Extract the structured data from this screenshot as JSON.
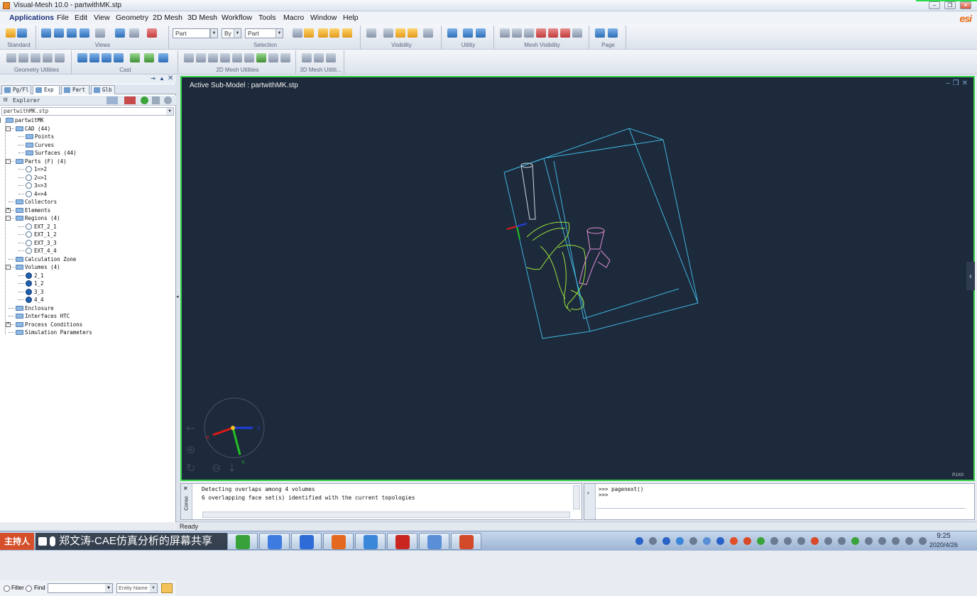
{
  "window": {
    "title": "Visual-Mesh 10.0 - partwithMK.stp",
    "controls": [
      "minimize",
      "restore",
      "close"
    ]
  },
  "menu": [
    "Applications",
    "File",
    "Edit",
    "View",
    "Geometry",
    "2D Mesh",
    "3D Mesh",
    "Workflow",
    "Tools",
    "Macro",
    "Window",
    "Help"
  ],
  "toolbar1": {
    "groups": [
      "Standard",
      "Views",
      "Selection",
      "Visibility",
      "Utility",
      "Mesh Visibility",
      "Page"
    ],
    "selection": {
      "part_left": "Part",
      "by": "By",
      "part_right": "Part"
    }
  },
  "toolbar2": {
    "groups": [
      "Geometry Utilities",
      "Cast",
      "2D Mesh Utilities",
      "3D Mesh Utiliti..."
    ]
  },
  "panel": {
    "tabs": [
      "Pg/Fl",
      "Exp",
      "Part",
      "Glb"
    ],
    "explorer_title": "Explorer",
    "model": "partwithMK.stp",
    "tree": [
      {
        "label": "partwitMK",
        "depth": 0,
        "icon": "folder",
        "exp": "-"
      },
      {
        "label": "CAD (44)",
        "depth": 1,
        "icon": "folder",
        "exp": "-"
      },
      {
        "label": "Points",
        "depth": 2,
        "icon": "folder"
      },
      {
        "label": "Curves",
        "depth": 2,
        "icon": "folder"
      },
      {
        "label": "Surfaces (44)",
        "depth": 2,
        "icon": "folder"
      },
      {
        "label": "Parts (F) (4)",
        "depth": 1,
        "icon": "folder",
        "exp": "-"
      },
      {
        "label": "1=>2",
        "depth": 2,
        "icon": "circle"
      },
      {
        "label": "2=>1",
        "depth": 2,
        "icon": "circle"
      },
      {
        "label": "3=>3",
        "depth": 2,
        "icon": "circle"
      },
      {
        "label": "4=>4",
        "depth": 2,
        "icon": "circle"
      },
      {
        "label": "Collectors",
        "depth": 1,
        "icon": "folder"
      },
      {
        "label": "Elements",
        "depth": 1,
        "icon": "folder",
        "exp": "+"
      },
      {
        "label": "Regions (4)",
        "depth": 1,
        "icon": "folder",
        "exp": "-"
      },
      {
        "label": "EXT_2_1",
        "depth": 2,
        "icon": "circle"
      },
      {
        "label": "EXT_1_2",
        "depth": 2,
        "icon": "circle"
      },
      {
        "label": "EXT_3_3",
        "depth": 2,
        "icon": "circle"
      },
      {
        "label": "EXT_4_4",
        "depth": 2,
        "icon": "circle"
      },
      {
        "label": "Calculation Zone",
        "depth": 1,
        "icon": "folder"
      },
      {
        "label": "Volumes (4)",
        "depth": 1,
        "icon": "folder",
        "exp": "-"
      },
      {
        "label": "2_1",
        "depth": 2,
        "icon": "circle-filled"
      },
      {
        "label": "1_2",
        "depth": 2,
        "icon": "circle-filled"
      },
      {
        "label": "3_3",
        "depth": 2,
        "icon": "circle-filled"
      },
      {
        "label": "4_4",
        "depth": 2,
        "icon": "circle-filled"
      },
      {
        "label": "Enclosure",
        "depth": 1,
        "icon": "folder"
      },
      {
        "label": "Interfaces HTC",
        "depth": 1,
        "icon": "folder"
      },
      {
        "label": "Process Conditions",
        "depth": 1,
        "icon": "folder",
        "exp": "+"
      },
      {
        "label": "Simulation Parameters",
        "depth": 1,
        "icon": "folder"
      }
    ],
    "filter": {
      "filter_label": "Filter",
      "find_label": "Find",
      "entity_name": "Entity Name"
    }
  },
  "viewport": {
    "title": "Active Sub-Model : partwithMK.stp",
    "corner_label": "P1X0",
    "background": "#1d2a3b",
    "border_color": "#35d24a",
    "colors": {
      "box": "#3fb4de",
      "part_green": "#9be23c",
      "part_pink": "#e48fd6",
      "axis_x": "#e01818",
      "axis_y": "#22c222",
      "axis_z": "#2040e0"
    },
    "triad_labels": {
      "x": "X",
      "y": "Y",
      "z": "Z"
    }
  },
  "console": {
    "tab_label": "Conso",
    "lines": [
      "Detecting overlaps among 4 volumes",
      "6 overlapping face set(s) identified with the current topologies"
    ]
  },
  "command": {
    "lines": [
      ">>> pagenext()",
      ">>>"
    ]
  },
  "status": {
    "text": "Ready"
  },
  "taskbar": {
    "presenter": "主持人",
    "share_label": "郑文涛-CAE仿真分析的屏幕共享",
    "time": "9:25",
    "date": "2020/4/26",
    "app_colors": [
      "#38a13a",
      "#3d7be0",
      "#2f6bd6",
      "#e4691e",
      "#3a86d9",
      "#c9261f",
      "#5a8fd8",
      "#d34a2a"
    ]
  }
}
